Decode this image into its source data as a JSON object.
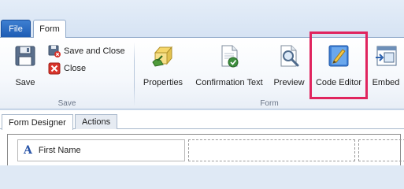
{
  "tabs": {
    "file": "File",
    "form": "Form"
  },
  "save_group": {
    "label": "Save",
    "save": "Save",
    "save_and_close": "Save and Close",
    "close": "Close"
  },
  "form_group": {
    "label": "Form",
    "buttons": [
      {
        "label": "Properties",
        "icon": "properties-icon"
      },
      {
        "label": "Confirmation Text",
        "icon": "confirmation-text-icon"
      },
      {
        "label": "Preview",
        "icon": "preview-icon"
      },
      {
        "label": "Code Editor",
        "icon": "code-editor-icon",
        "highlighted": true
      },
      {
        "label": "Embed",
        "icon": "embed-icon"
      }
    ]
  },
  "doc_tabs": [
    "Form Designer",
    "Actions"
  ],
  "designer": {
    "field_label": "First Name"
  },
  "colors": {
    "highlight": "#e0245e",
    "file_tab": "#1d5cb4"
  }
}
